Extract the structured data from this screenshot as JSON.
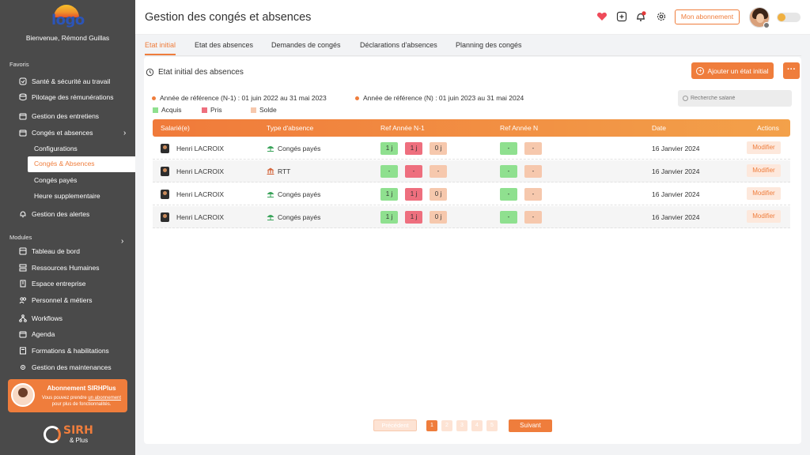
{
  "app": {
    "logo_text": "logo",
    "welcome": "Bienvenue, Rémond Guillas",
    "page_title": "Gestion des congés et absences",
    "subscription_button": "Mon abonnement"
  },
  "sidebar": {
    "favoris_title": "Favoris",
    "modules_title": "Modules",
    "favoris": [
      {
        "label": "Santé & sécurité au travail",
        "icon": "shield-icon"
      },
      {
        "label": "Pilotage des rémunérations",
        "icon": "database-icon"
      },
      {
        "label": "Gestion des entretiens",
        "icon": "calendar-icon"
      },
      {
        "label": "Congés et absences",
        "icon": "calendar-icon"
      }
    ],
    "sub_items": [
      "Configurations",
      "Congés & Absences",
      "Congés payés",
      "Heure supplementaire"
    ],
    "alerts": "Gestion des alertes",
    "modules": [
      "Tableau de bord",
      "Ressources Humaines",
      "Espace entreprise",
      "Personnel & métiers",
      "Workflows",
      "Agenda",
      "Formations & habilitations",
      "Gestion des maintenances"
    ],
    "promo": {
      "title": "Abonnement SIRHPlus",
      "text_before": "Vous pouvez prendre",
      "text_link": "un abonnement",
      "text_after": "pour plus de fonctionnalités."
    },
    "brand": {
      "name": "SIRH",
      "sub": "& Plus"
    }
  },
  "tabs": [
    "Etat initial",
    "Etat des absences",
    "Demandes de congés",
    "Déclarations d'absences",
    "Planning des congés"
  ],
  "content": {
    "section_title": "Etat initial des absences",
    "add_button": "Ajouter un état initial",
    "more_button": "···",
    "ref_prev": "Année de référence (N-1) : 01 juin 2022 au 31 mai 2023",
    "ref_curr": "Année de référence (N) : 01 juin 2023 au 31 mai 2024",
    "legend": [
      {
        "label": "Acquis",
        "color": "#8fe08f"
      },
      {
        "label": "Pris",
        "color": "#ee6f7e"
      },
      {
        "label": "Solde",
        "color": "#f6c8ad"
      }
    ],
    "search_placeholder": "Recherche salarié"
  },
  "table": {
    "headers": [
      "Salarié(e)",
      "Type d'absence",
      "Ref Année N-1",
      "Ref Année N",
      "Date",
      "Actions"
    ],
    "rows": [
      {
        "employee": "Henri LACROIX",
        "type": "Congés payés",
        "type_icon": "umbrella-icon",
        "n1": [
          "1 j",
          "1 j",
          "0 j"
        ],
        "n": [
          "-",
          "-"
        ],
        "date": "16 Janvier 2024",
        "action": "Modifier"
      },
      {
        "employee": "Henri LACROIX",
        "type": "RTT",
        "type_icon": "building-icon",
        "n1": [
          "-",
          "-",
          "-"
        ],
        "n": [
          "-",
          "-"
        ],
        "date": "16 Janvier 2024",
        "action": "Modifier"
      },
      {
        "employee": "Henri LACROIX",
        "type": "Congés payés",
        "type_icon": "umbrella-icon",
        "n1": [
          "1 j",
          "1 j",
          "0 j"
        ],
        "n": [
          "-",
          "-"
        ],
        "date": "16 Janvier 2024",
        "action": "Modifier"
      },
      {
        "employee": "Henri LACROIX",
        "type": "Congés payés",
        "type_icon": "umbrella-icon",
        "n1": [
          "1 j",
          "1 j",
          "0 j"
        ],
        "n": [
          "-",
          "-"
        ],
        "date": "16 Janvier 2024",
        "action": "Modifier"
      }
    ]
  },
  "pagination": {
    "prev": "Précédent",
    "next": "Suivant",
    "pages": [
      "1",
      "2",
      "3",
      "4",
      "5"
    ],
    "current": "1"
  },
  "colors": {
    "accent": "#ef7d3c",
    "sidebar": "#4a4a4a"
  }
}
